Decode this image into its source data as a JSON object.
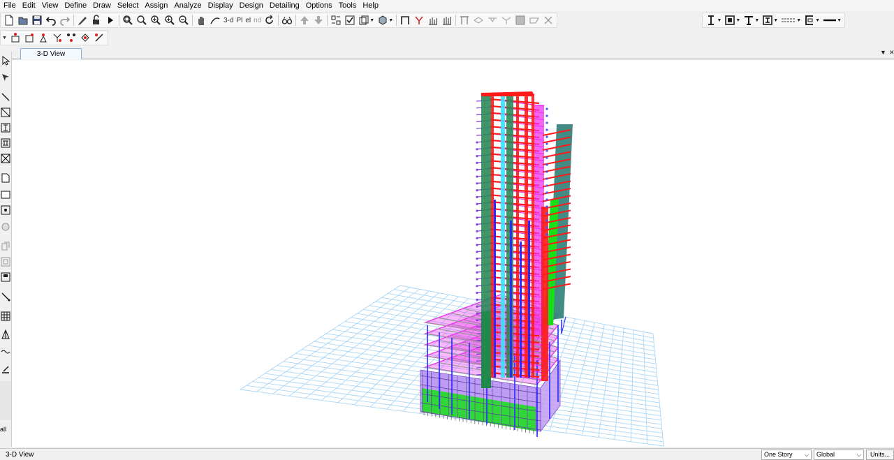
{
  "menu": [
    "File",
    "Edit",
    "View",
    "Define",
    "Draw",
    "Select",
    "Assign",
    "Analyze",
    "Display",
    "Design",
    "Detailing",
    "Options",
    "Tools",
    "Help"
  ],
  "toolbar": {
    "view_3d_label": "3-d",
    "plan_label": "Pl",
    "elev_label": "el",
    "nd_label": "nd",
    "icons": [
      "new-file-icon",
      "open-icon",
      "save-icon",
      "undo-icon",
      "redo-icon",
      "pencil-icon",
      "lock-icon",
      "run-icon",
      "zoom-window-icon",
      "zoom-restore-icon",
      "zoom-in-icon",
      "zoom-out-icon",
      "pan-icon",
      "rubber-band-icon",
      "rotate-icon",
      "glasses-icon",
      "move-up-icon",
      "move-down-icon",
      "set-elements-icon",
      "check-icon",
      "objects-icon",
      "shrink-icon",
      "frame-icon",
      "link-icon",
      "bars-icon",
      "stairs-icon",
      "beam-icon",
      "slab-icon",
      "wall-icon"
    ],
    "right_icons": [
      "column-section-icon",
      "wall-section-icon",
      "beam-section-icon",
      "i-section-icon",
      "brace-icon",
      "channel-icon",
      "line-style-icon"
    ]
  },
  "toolbar2": {
    "icons": [
      "point-load-icon",
      "restraint-icon",
      "spring-icon",
      "mass-icon",
      "joint-icon",
      "diaphragm-icon",
      "link-support-icon"
    ]
  },
  "left_toolbar": {
    "icons": [
      "pointer-icon",
      "reshape-icon",
      "draw-line-icon",
      "draw-brace-icon",
      "draw-column-icon",
      "draw-beam-icon",
      "draw-secondary-icon",
      "draw-floor-icon",
      "draw-rect-icon",
      "draw-opening-icon",
      "draw-point-icon",
      "draw-wall-icon",
      "draw-wall-stack-icon",
      "draw-pier-icon",
      "draw-dimension-icon",
      "draw-grid-icon",
      "draw-tendon-icon",
      "draw-spring-icon",
      "draw-ref-line-icon"
    ],
    "bottom_label": "all"
  },
  "tab": {
    "label": "3-D View"
  },
  "statusbar": {
    "text": "3-D View",
    "story_select": "One Story",
    "coord_select": "Global",
    "units_button": "Units..."
  },
  "colors": {
    "grid": "#a9d6f5",
    "beam_red": "#ff1a1a",
    "column_green": "#18e018",
    "slab_magenta": "#ee33ee",
    "wall_blue": "#2a2aff",
    "brace_cyan": "#33e6ff",
    "panel_purple": "#b48cf0",
    "gray": "#888888"
  }
}
